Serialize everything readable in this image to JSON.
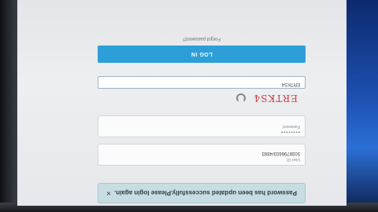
{
  "alert": {
    "message": "Password has been updated successfully.Please login again.",
    "close": "×"
  },
  "user_id": {
    "label": "User ID",
    "value": "5038796603/4883"
  },
  "password": {
    "label": "Password",
    "mask": "••••••••"
  },
  "captcha": {
    "code": "ERTKS4",
    "input_value": "ERTKS4"
  },
  "login": {
    "label": "LOG IN"
  },
  "forgot": {
    "label": "Forgot password?"
  },
  "icons": {
    "refresh": "refresh-icon",
    "close": "close-icon"
  },
  "colors": {
    "login_button": "#2c9fd9",
    "captcha_text": "#d23a3a",
    "alert_bg": "#c7dde2"
  }
}
